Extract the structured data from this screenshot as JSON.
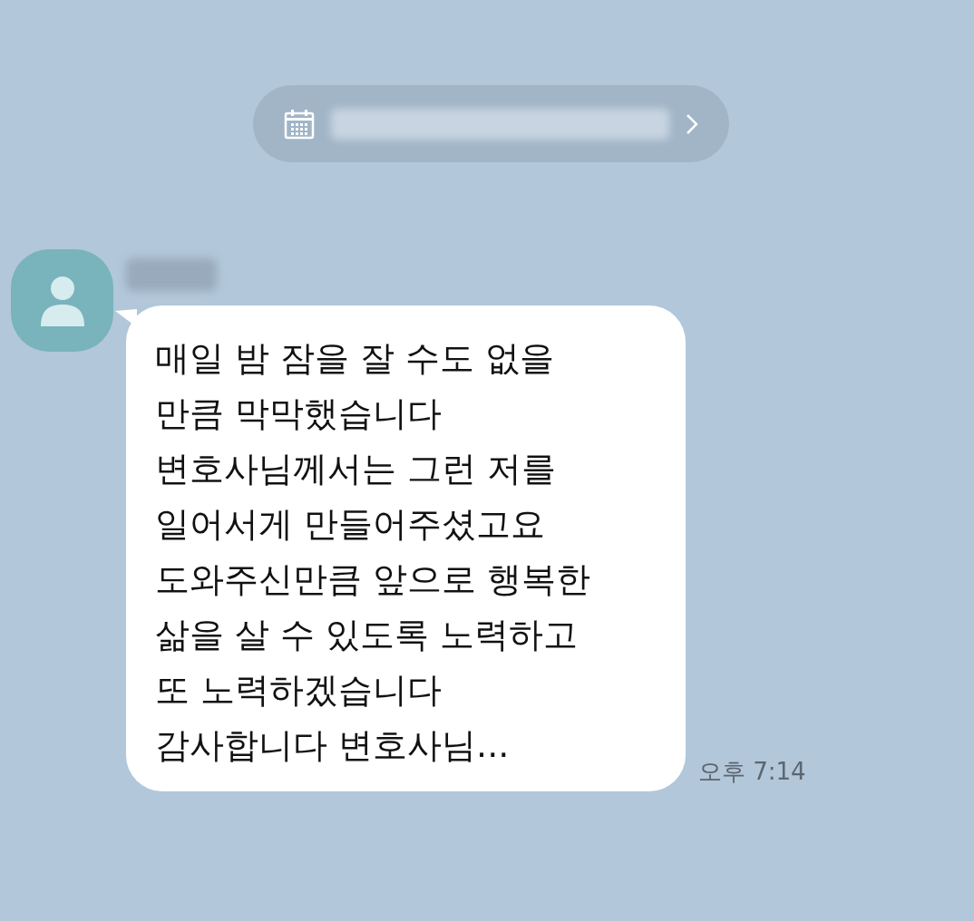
{
  "message": {
    "lines": [
      "매일 밤 잠을 잘 수도 없을",
      "만큼 막막했습니다",
      "변호사님께서는 그런 저를",
      "일어서게 만들어주셨고요",
      "도와주신만큼 앞으로 행복한",
      "삶을 살 수 있도록 노력하고",
      "또 노력하겠습니다",
      "감사합니다 변호사님..."
    ],
    "time": "오후 7:14"
  }
}
